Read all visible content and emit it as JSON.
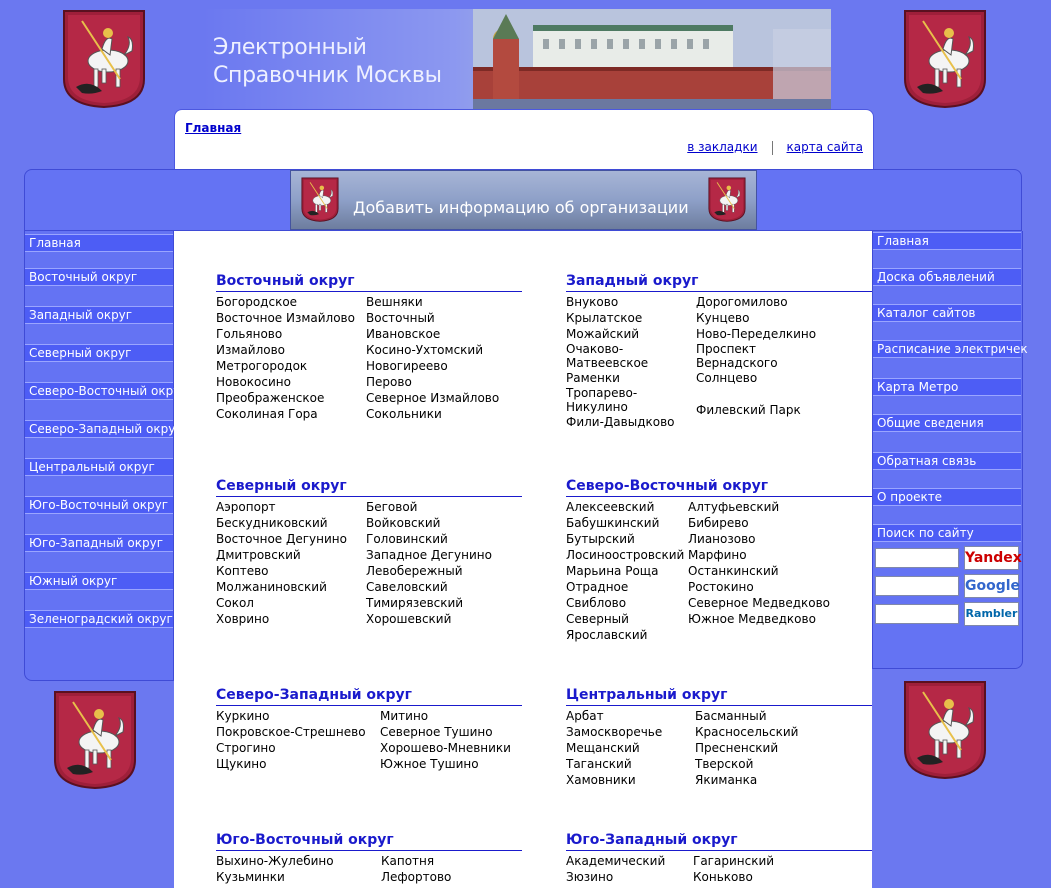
{
  "header": {
    "title_line1": "Электронный",
    "title_line2": "Справочник Москвы"
  },
  "top_panel": {
    "breadcrumb": "Главная",
    "links": [
      "в закладки",
      "карта сайта"
    ]
  },
  "add_banner": {
    "text": "Добавить информацию об организации"
  },
  "left_nav": [
    "Главная",
    "Восточный округ",
    "Западный округ",
    "Северный округ",
    "Северо-Восточный округ",
    "Северо-Западный округ",
    "Центральный округ",
    "Юго-Восточный округ",
    "Юго-Западный округ",
    "Южный округ",
    "Зеленоградский округ"
  ],
  "right_nav": [
    "Главная",
    "Доска объявлений",
    "Каталог сайтов",
    "Расписание электричек",
    "Карта Метро",
    "Общие сведения",
    "Обратная связь",
    "О проекте",
    "Поиск по сайту"
  ],
  "search": {
    "engines": [
      "Yandex",
      "Google",
      "Rambler"
    ]
  },
  "colors": {
    "background": "#6b78f0",
    "nav_item": "#4d5df5",
    "heading": "#1a1acc"
  },
  "districts": [
    {
      "title": "Восточный округ",
      "col1": [
        "Богородское",
        "Восточное Измайлово",
        "Гольяново",
        "Измайлово",
        "Метрогородок",
        "Новокосино",
        "Преображенское",
        "Соколиная Гора"
      ],
      "col2": [
        "Вешняки",
        "Восточный",
        "Ивановское",
        "Косино-Ухтомский",
        "Новогиреево",
        "Перово",
        "Северное Измайлово",
        "Сокольники"
      ]
    },
    {
      "title": "Западный округ",
      "col1": [
        "Внуково",
        "Крылатское",
        "Можайский",
        "Очаково-\nМатвеевское",
        "Раменки",
        "Тропарево-\nНикулино",
        "Фили-Давыдково"
      ],
      "col2": [
        "Дорогомилово",
        "Кунцево",
        "Ново-Переделкино",
        "Проспект\nВернадского",
        "Солнцево",
        "",
        "Филевский Парк"
      ]
    },
    {
      "title": "Северный округ",
      "col1": [
        "Аэропорт",
        "Бескудниковский",
        "Восточное Дегунино",
        "Дмитровский",
        "Коптево",
        "Молжаниновский",
        "Сокол",
        "Ховрино"
      ],
      "col2": [
        "Беговой",
        "Войковский",
        "Головинский",
        "Западное Дегунино",
        "Левобережный",
        "Савеловский",
        "Тимирязевский",
        "Хорошевский"
      ]
    },
    {
      "title": "Северо-Восточный округ",
      "col1": [
        "Алексеевский",
        "Бабушкинский",
        "Бутырский",
        "Лосиноостровский",
        "Марьина Роща",
        "Отрадное",
        "Свиблово",
        "Северный",
        "Ярославский"
      ],
      "col2": [
        "Алтуфьевский",
        "Бибирево",
        "Лианозово",
        "Марфино",
        "Останкинский",
        "Ростокино",
        "Северное Медведково",
        "Южное Медведково"
      ]
    },
    {
      "title": "Северо-Западный округ",
      "col1": [
        "Куркино",
        "Покровское-Стрешнево",
        "Строгино",
        "Щукино"
      ],
      "col2": [
        "Митино",
        "Северное Тушино",
        "Хорошево-Мневники",
        "Южное Тушино"
      ]
    },
    {
      "title": "Центральный округ",
      "col1": [
        "Арбат",
        "Замоскворечье",
        "Мещанский",
        "Таганский",
        "Хамовники"
      ],
      "col2": [
        "Басманный",
        "Красносельский",
        "Пресненский",
        "Тверской",
        "Якиманка"
      ]
    },
    {
      "title": "Юго-Восточный округ",
      "col1": [
        "Выхино-Жулебино",
        "Кузьминки"
      ],
      "col2": [
        "Капотня",
        "Лефортово"
      ]
    },
    {
      "title": "Юго-Западный округ",
      "col1": [
        "Академический",
        "Зюзино"
      ],
      "col2": [
        "Гагаринский",
        "Коньково"
      ]
    }
  ]
}
